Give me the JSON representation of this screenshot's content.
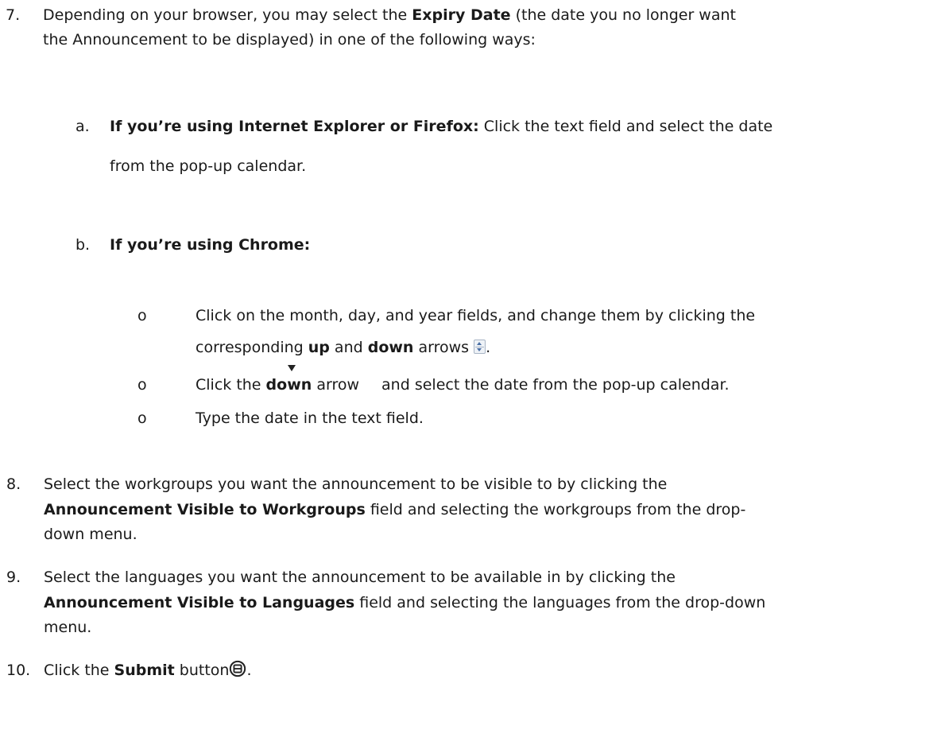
{
  "steps": {
    "s7": {
      "num": "7.",
      "l1_pre": "Depending on your browser, you may select the ",
      "l1_bold": "Expiry Date",
      "l1_post": " (the date you no longer want",
      "l2": "the Announcement to be displayed) in one of the following ways:",
      "a": {
        "letter": "a.",
        "bold": "If you’re using Internet Explorer or Firefox:",
        "text": " Click the text field and select the date",
        "l2": "from the pop-up calendar."
      },
      "b": {
        "letter": "b.",
        "bold": "If you’re using Chrome:",
        "bullet": "o",
        "i1_l1": "Click on the month, day, and year fields, and change them by clicking the",
        "i1_l2_pre": "corresponding ",
        "i1_up": "up",
        "i1_and": " and ",
        "i1_down": "down",
        "i1_post": " arrows ",
        "i1_end": ".",
        "i2_pre": "Click the ",
        "i2_down": "down",
        "i2_mid": " arrow",
        "i2_post": " and select the date from the pop-up calendar.",
        "i3": "Type the date in the text field."
      }
    },
    "s8": {
      "num": "8.",
      "l1": "Select the workgroups you want the announcement to be visible to by clicking the",
      "l2_bold": "Announcement Visible to Workgroups",
      "l2_post": " field and selecting the workgroups from the drop-",
      "l3": "down menu."
    },
    "s9": {
      "num": "9.",
      "l1": "Select the languages you want the announcement to be available in by clicking the",
      "l2_bold": "Announcement Visible to Languages",
      "l2_post": " field and selecting the languages from the drop-down",
      "l3": "menu."
    },
    "s10": {
      "num": "10.",
      "pre": "Click the ",
      "bold": "Submit",
      "post": " button",
      "end": "."
    }
  },
  "icons": {
    "spinner": "up-down-spinner-icon",
    "dropdown": "dropdown-arrow-icon",
    "submit": "submit-button-icon"
  }
}
